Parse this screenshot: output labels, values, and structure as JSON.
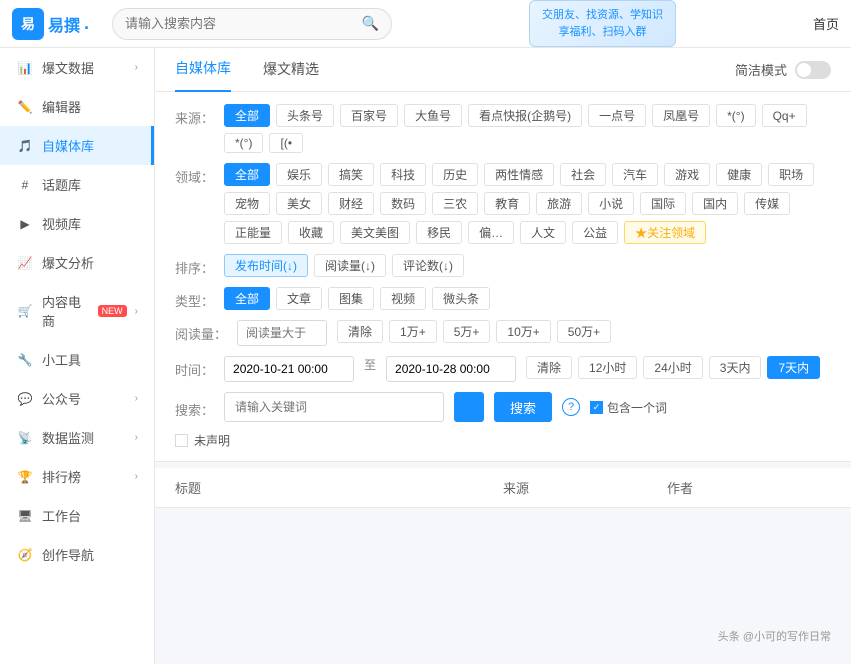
{
  "logo": {
    "icon_text": "易",
    "name": "易撰",
    "dot": "."
  },
  "top_nav": {
    "search_placeholder": "请输入搜索内容",
    "home_label": "首页",
    "banner_line1": "交朋友、找资源、学知识",
    "banner_line2": "享福利、扫码入群"
  },
  "sidebar": {
    "items": [
      {
        "id": "baobao-data",
        "icon": "📊",
        "label": "爆文数据",
        "has_chevron": true,
        "active": false
      },
      {
        "id": "bianji-qi",
        "icon": "✏️",
        "label": "编辑器",
        "has_chevron": false,
        "active": false
      },
      {
        "id": "zimeiti-ku",
        "icon": "🎵",
        "label": "自媒体库",
        "has_chevron": false,
        "active": true
      },
      {
        "id": "huati-ku",
        "icon": "#",
        "label": "话题库",
        "has_chevron": false,
        "active": false
      },
      {
        "id": "shipin-ku",
        "icon": "▶",
        "label": "视频库",
        "has_chevron": false,
        "active": false
      },
      {
        "id": "baobao-fenxi",
        "icon": "📈",
        "label": "爆文分析",
        "has_chevron": false,
        "active": false
      },
      {
        "id": "neirong-dianshang",
        "icon": "🛒",
        "label": "内容电商",
        "has_chevron": true,
        "active": false,
        "badge": "NEW"
      },
      {
        "id": "xiao-gongju",
        "icon": "🔧",
        "label": "小工具",
        "has_chevron": false,
        "active": false
      },
      {
        "id": "gongzhong-hao",
        "icon": "💬",
        "label": "公众号",
        "has_chevron": true,
        "active": false
      },
      {
        "id": "shuju-jiance",
        "icon": "📡",
        "label": "数据监测",
        "has_chevron": true,
        "active": false
      },
      {
        "id": "paihang-bang",
        "icon": "🏆",
        "label": "排行榜",
        "has_chevron": true,
        "active": false
      },
      {
        "id": "gong-zuo-tai",
        "icon": "🖥",
        "label": "工作台",
        "has_chevron": false,
        "active": false
      },
      {
        "id": "chuangzuo-daohang",
        "icon": "🧭",
        "label": "创作导航",
        "has_chevron": false,
        "active": false
      }
    ]
  },
  "tabs": {
    "items": [
      {
        "id": "zimeiti-ku-tab",
        "label": "自媒体库",
        "active": true
      },
      {
        "id": "baobao-jingxuan-tab",
        "label": "爆文精选",
        "active": false
      }
    ],
    "simple_mode_label": "简洁模式"
  },
  "filters": {
    "source_label": "来源：",
    "sources": [
      {
        "id": "all",
        "label": "全部",
        "active": true
      },
      {
        "id": "toutiao",
        "label": "头条号",
        "active": false
      },
      {
        "id": "baijia",
        "label": "百家号",
        "active": false
      },
      {
        "id": "dayu",
        "label": "大鱼号",
        "active": false
      },
      {
        "id": "kandiankuaibao",
        "label": "看点快报(企鹅号)",
        "active": false
      },
      {
        "id": "yidian",
        "label": "一点号",
        "active": false
      },
      {
        "id": "fenghuang",
        "label": "凤凰号",
        "active": false
      },
      {
        "id": "weibo",
        "label": "*(°)",
        "active": false
      },
      {
        "id": "qq",
        "label": "Qq+",
        "active": false
      },
      {
        "id": "zhihu",
        "label": "*(°)",
        "active": false
      },
      {
        "id": "bilibili",
        "label": "[(•",
        "active": false
      }
    ],
    "domain_label": "领域：",
    "domains": [
      {
        "id": "all",
        "label": "全部",
        "active": true
      },
      {
        "id": "yule",
        "label": "娱乐",
        "active": false
      },
      {
        "id": "gaoyan",
        "label": "搞笑",
        "active": false
      },
      {
        "id": "keji",
        "label": "科技",
        "active": false
      },
      {
        "id": "lishi",
        "label": "历史",
        "active": false
      },
      {
        "id": "liangxingqinggan",
        "label": "两性情感",
        "active": false
      },
      {
        "id": "shehui",
        "label": "社会",
        "active": false
      },
      {
        "id": "qiche",
        "label": "汽车",
        "active": false
      },
      {
        "id": "youxi",
        "label": "游戏",
        "active": false
      },
      {
        "id": "jiankang",
        "label": "健康",
        "active": false
      },
      {
        "id": "zhichang",
        "label": "职场",
        "active": false
      },
      {
        "id": "chongwu",
        "label": "宠物",
        "active": false
      },
      {
        "id": "meinv",
        "label": "美女",
        "active": false
      },
      {
        "id": "caijing",
        "label": "财经",
        "active": false
      },
      {
        "id": "shuma",
        "label": "数码",
        "active": false
      },
      {
        "id": "sannong",
        "label": "三农",
        "active": false
      },
      {
        "id": "jiaoyu",
        "label": "教育",
        "active": false
      },
      {
        "id": "lvyou",
        "label": "旅游",
        "active": false
      },
      {
        "id": "xiaoshuo",
        "label": "小说",
        "active": false
      },
      {
        "id": "guoji",
        "label": "国际",
        "active": false
      },
      {
        "id": "guonei",
        "label": "国内",
        "active": false
      },
      {
        "id": "chuanmei",
        "label": "传媒",
        "active": false
      },
      {
        "id": "zhengnengliangyi",
        "label": "正能量",
        "active": false
      },
      {
        "id": "shoucang",
        "label": "收藏",
        "active": false
      },
      {
        "id": "meiwen",
        "label": "美文美图",
        "active": false
      },
      {
        "id": "yimin",
        "label": "移民",
        "active": false
      },
      {
        "id": "other1",
        "label": "偏…",
        "active": false
      },
      {
        "id": "renwen",
        "label": "人文",
        "active": false
      },
      {
        "id": "gongyi",
        "label": "公益",
        "active": false
      },
      {
        "id": "guanzhu-lingyu",
        "label": "★关注领域",
        "active": false,
        "highlight": true
      }
    ],
    "sort_label": "排序：",
    "sorts": [
      {
        "id": "publish-time",
        "label": "发布时间(↓)",
        "active": true
      },
      {
        "id": "read-count",
        "label": "阅读量(↓)",
        "active": false
      },
      {
        "id": "comment-count",
        "label": "评论数(↓)",
        "active": false
      }
    ],
    "type_label": "类型：",
    "types": [
      {
        "id": "all",
        "label": "全部",
        "active": true
      },
      {
        "id": "article",
        "label": "文章",
        "active": false
      },
      {
        "id": "gallery",
        "label": "图集",
        "active": false
      },
      {
        "id": "video",
        "label": "视频",
        "active": false
      },
      {
        "id": "micro-headline",
        "label": "微头条",
        "active": false
      }
    ],
    "read_label": "阅读量：",
    "read_placeholder": "阅读量大于",
    "read_options": [
      "清除",
      "1万+",
      "5万+",
      "10万+",
      "50万+"
    ],
    "time_label": "时间：",
    "time_start": "2020-10-21 00:00",
    "time_to": "至",
    "time_end": "2020-10-28 00:00",
    "time_options": [
      "清除",
      "12小时",
      "24小时",
      "3天内",
      "7天内"
    ],
    "time_active": "7天内",
    "search_label": "搜索：",
    "search_keyword_placeholder": "请输入关键词",
    "search_btn_label": "搜索",
    "include_one_word": "包含一个词",
    "undeclared_label": "未声明"
  },
  "table": {
    "columns": [
      "标题",
      "来源",
      "作者"
    ]
  },
  "watermark": {
    "text": "头条 @小可的写作日常"
  }
}
